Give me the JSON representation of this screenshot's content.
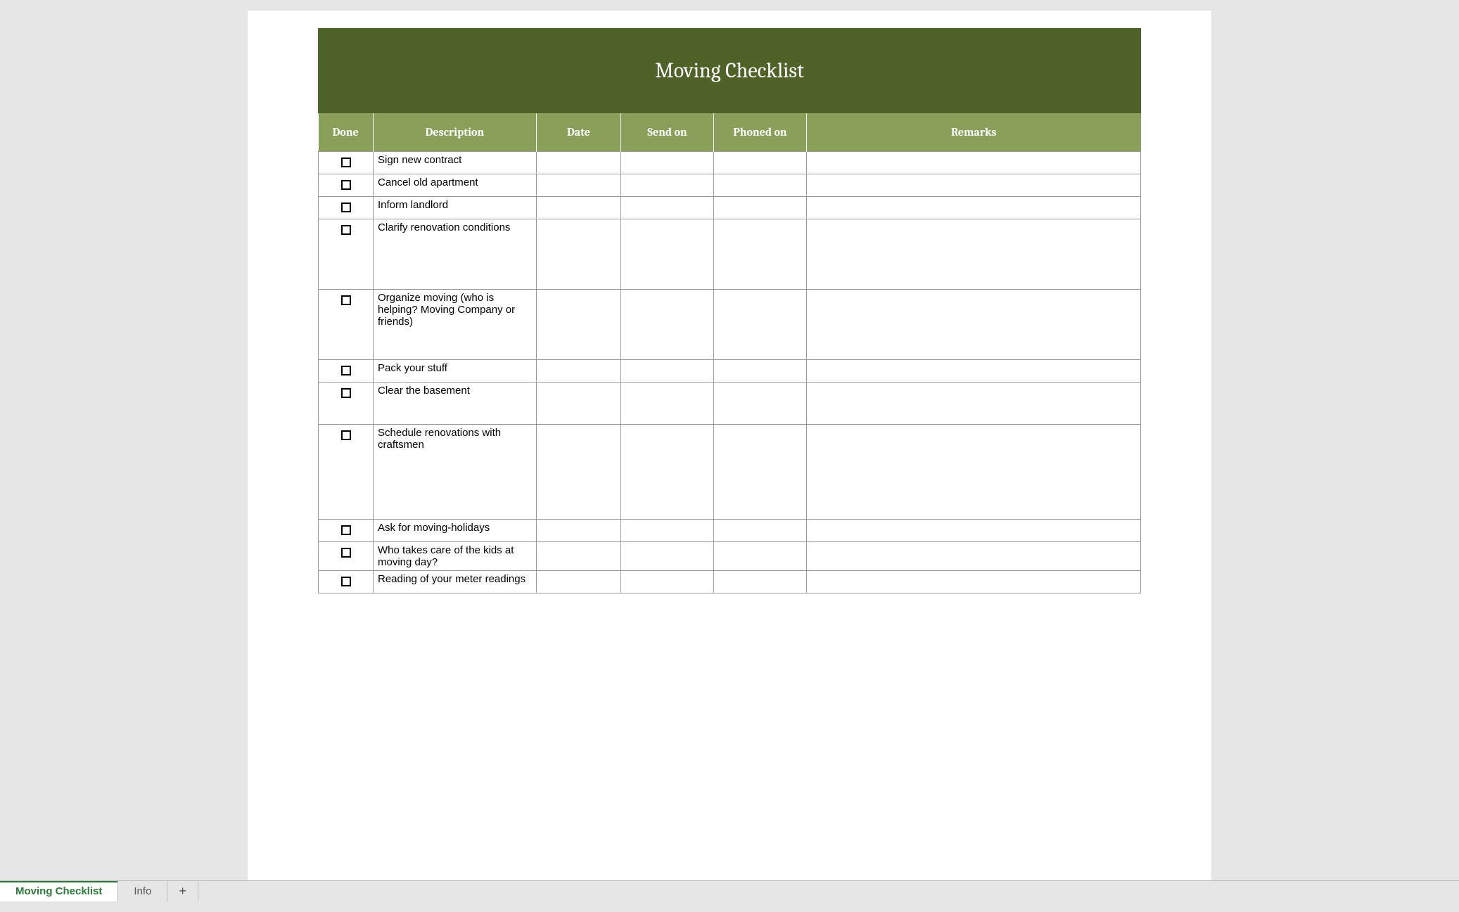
{
  "title": "Moving Checklist",
  "columns": {
    "done": "Done",
    "description": "Description",
    "date": "Date",
    "send_on": "Send on",
    "phoned_on": "Phoned on",
    "remarks": "Remarks"
  },
  "rows": [
    {
      "description": "Sign new contract",
      "h": 1
    },
    {
      "description": "Cancel old apartment",
      "h": 1
    },
    {
      "description": "Inform landlord",
      "h": 1
    },
    {
      "description": "Clarify renovation conditions",
      "h": 2
    },
    {
      "description": "Organize moving (who is helping? Moving Company or friends)",
      "h": 2
    },
    {
      "description": "Pack your stuff",
      "h": 1
    },
    {
      "description": "Clear the basement",
      "h": 3
    },
    {
      "description": "Schedule renovations with craftsmen",
      "h": 4
    },
    {
      "description": "Ask for moving-holidays",
      "h": 1
    },
    {
      "description": "Who takes care of the kids at moving day?",
      "h": 1
    },
    {
      "description": "Reading of your meter readings",
      "h": 1
    }
  ],
  "tabs": {
    "active": "Moving Checklist",
    "other": "Info",
    "add": "+"
  }
}
